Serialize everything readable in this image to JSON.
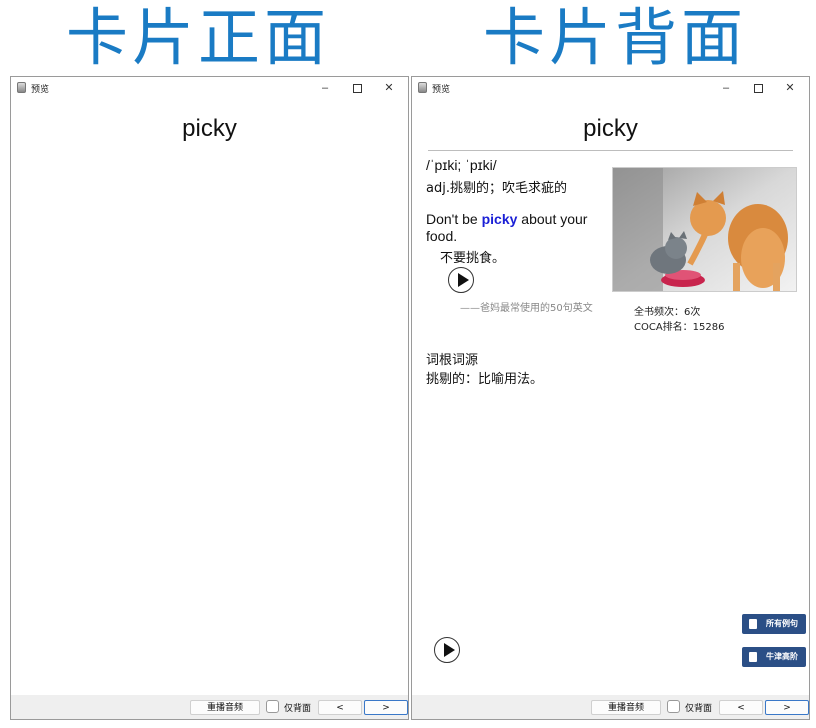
{
  "headings": {
    "front": "卡片正面",
    "back": "卡片背面"
  },
  "window": {
    "title": "预览",
    "controls": {
      "minimize": "–",
      "close": "✕"
    }
  },
  "card": {
    "word": "picky",
    "phonetic": "/ˈpɪki; ˈpɪki/",
    "definition": "adj.挑剔的；吹毛求疵的",
    "example_before": "Don't be ",
    "example_highlight": "picky",
    "example_after": " about your",
    "example_line2": "food.",
    "example_translation": "不要挑食。",
    "example_source": "——爸妈最常使用的50句英文",
    "book_frequency": "全书频次：6次",
    "coca_rank": "COCA排名：15286",
    "etymology_title": "词根词源",
    "etymology_text": "挑剔的：比喻用法。",
    "side_buttons": {
      "all_examples": "所有例句",
      "oxford": "牛津高阶"
    },
    "image_subject": "cats-eating-photo"
  },
  "bottombar": {
    "replay": "重播音频",
    "back_only": "仅背面",
    "back_only_checked": false,
    "prev": "<",
    "next": ">"
  },
  "icons": {
    "play": "play-icon",
    "app": "app-icon"
  },
  "colors": {
    "heading": "#1a7bc4",
    "highlight": "#1a1fd6",
    "side_button": "#2b4f86"
  }
}
